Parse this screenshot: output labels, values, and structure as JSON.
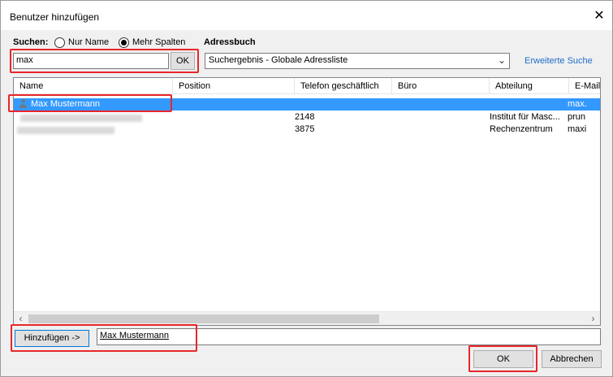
{
  "window": {
    "title": "Benutzer hinzufügen",
    "close_glyph": "✕"
  },
  "search": {
    "label": "Suchen:",
    "option_name_only": "Nur Name",
    "option_more_columns": "Mehr Spalten",
    "selected_option": "Mehr Spalten",
    "value": "max",
    "ok_label": "OK"
  },
  "addressbook": {
    "label": "Adressbuch",
    "selected": "Suchergebnis - Globale Adressliste",
    "advanced_search": "Erweiterte Suche"
  },
  "table": {
    "columns": [
      "Name",
      "Position",
      "Telefon geschäftlich",
      "Büro",
      "Abteilung",
      "E-Mail"
    ],
    "rows": [
      {
        "name": "Max Mustermann",
        "position": "",
        "phone": "",
        "office": "",
        "department": "",
        "email": "max.",
        "selected": true
      },
      {
        "name": "",
        "position": "",
        "phone": "2148",
        "office": "",
        "department": "Institut für Masc...",
        "email": "prun",
        "selected": false
      },
      {
        "name": "",
        "position": "",
        "phone": "3875",
        "office": "",
        "department": "Rechenzentrum",
        "email": "maxi",
        "selected": false
      }
    ]
  },
  "add": {
    "button_label": "Hinzufügen ->",
    "value": "Max Mustermann"
  },
  "footer": {
    "ok_label": "OK",
    "cancel_label": "Abbrechen"
  },
  "colors": {
    "highlight": "#e8262a",
    "selection": "#3399ff",
    "link": "#1e6ec8"
  }
}
